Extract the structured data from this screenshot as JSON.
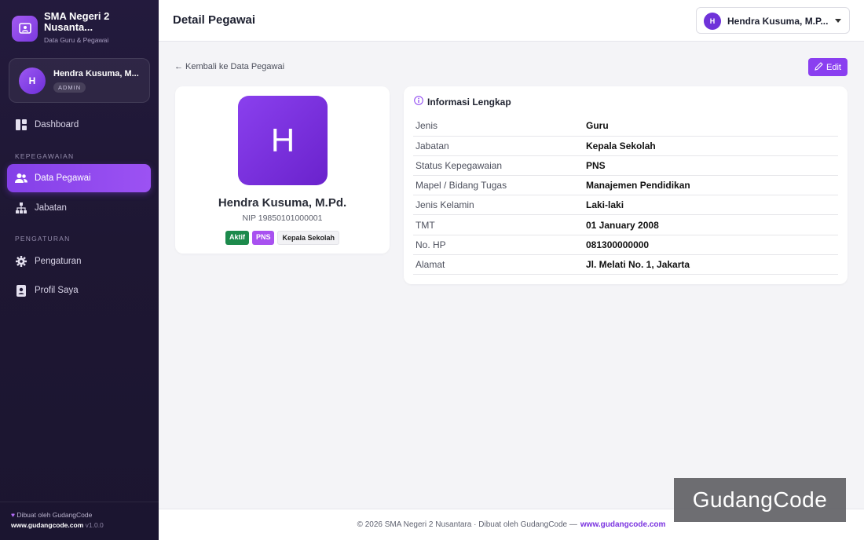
{
  "sidebar": {
    "brand_title": "SMA Negeri 2 Nusanta...",
    "brand_sub": "Data Guru & Pegawai",
    "user": {
      "initial": "H",
      "name": "Hendra Kusuma, M...",
      "role": "ADMIN"
    },
    "items": {
      "dashboard": "Dashboard",
      "section_kepegawaian": "KEPEGAWAIAN",
      "data_pegawai": "Data Pegawai",
      "jabatan": "Jabatan",
      "section_pengaturan": "PENGATURAN",
      "pengaturan": "Pengaturan",
      "profil": "Profil Saya"
    },
    "footer": {
      "credit": "Dibuat oleh GudangCode",
      "site": "www.gudangcode.com",
      "version": "v1.0.0"
    }
  },
  "header": {
    "title": "Detail Pegawai",
    "user_initial": "H",
    "user_name": "Hendra Kusuma, M.P..."
  },
  "content": {
    "back_label": "← Kembali ke Data Pegawai",
    "edit_label": "Edit"
  },
  "profile": {
    "initial": "H",
    "name": "Hendra Kusuma, M.Pd.",
    "nip": "NIP 19850101000001",
    "badges": {
      "status": "Aktif",
      "type": "PNS",
      "position": "Kepala Sekolah"
    }
  },
  "info": {
    "title": "Informasi Lengkap",
    "rows": [
      {
        "key": "Jenis",
        "value": "Guru"
      },
      {
        "key": "Jabatan",
        "value": "Kepala Sekolah"
      },
      {
        "key": "Status Kepegawaian",
        "value": "PNS"
      },
      {
        "key": "Mapel / Bidang Tugas",
        "value": "Manajemen Pendidikan"
      },
      {
        "key": "Jenis Kelamin",
        "value": "Laki-laki"
      },
      {
        "key": "TMT",
        "value": "01 January 2008"
      },
      {
        "key": "No. HP",
        "value": "081300000000"
      },
      {
        "key": "Alamat",
        "value": "Jl. Melati No. 1, Jakarta"
      }
    ]
  },
  "footer": {
    "text": "© 2026 SMA Negeri 2 Nusantara · Dibuat oleh GudangCode —",
    "link": "www.gudangcode.com"
  },
  "watermark": "GudangCode",
  "colors": {
    "accent": "#8a3ff0",
    "sidebar_bg": "#1e1733",
    "success": "#1c8a4c",
    "pns": "#a851f0"
  }
}
